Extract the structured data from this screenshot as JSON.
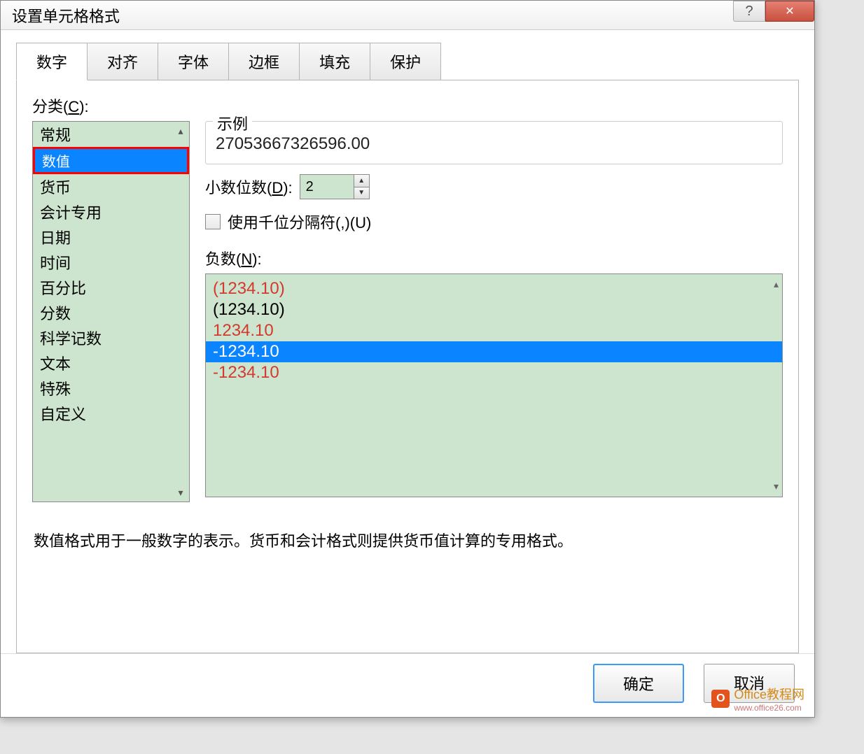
{
  "titlebar": {
    "title": "设置单元格格式",
    "help_symbol": "?",
    "close_symbol": "✕"
  },
  "tabs": [
    {
      "label": "数字",
      "active": true
    },
    {
      "label": "对齐",
      "active": false
    },
    {
      "label": "字体",
      "active": false
    },
    {
      "label": "边框",
      "active": false
    },
    {
      "label": "填充",
      "active": false
    },
    {
      "label": "保护",
      "active": false
    }
  ],
  "category": {
    "label_prefix": "分类(",
    "label_ul": "C",
    "label_suffix": "):",
    "items": [
      {
        "label": "常规",
        "selected": false,
        "highlighted": false
      },
      {
        "label": "数值",
        "selected": true,
        "highlighted": true
      },
      {
        "label": "货币",
        "selected": false,
        "highlighted": false
      },
      {
        "label": "会计专用",
        "selected": false,
        "highlighted": false
      },
      {
        "label": "日期",
        "selected": false,
        "highlighted": false
      },
      {
        "label": "时间",
        "selected": false,
        "highlighted": false
      },
      {
        "label": "百分比",
        "selected": false,
        "highlighted": false
      },
      {
        "label": "分数",
        "selected": false,
        "highlighted": false
      },
      {
        "label": "科学记数",
        "selected": false,
        "highlighted": false
      },
      {
        "label": "文本",
        "selected": false,
        "highlighted": false
      },
      {
        "label": "特殊",
        "selected": false,
        "highlighted": false
      },
      {
        "label": "自定义",
        "selected": false,
        "highlighted": false
      }
    ]
  },
  "sample": {
    "legend": "示例",
    "value": "27053667326596.00"
  },
  "decimal": {
    "label_prefix": "小数位数(",
    "label_ul": "D",
    "label_suffix": "):",
    "value": "2"
  },
  "thousands": {
    "checked": false,
    "label_prefix": "使用千位分隔符(,)(",
    "label_ul": "U",
    "label_suffix": ")"
  },
  "negatives": {
    "label_prefix": "负数(",
    "label_ul": "N",
    "label_suffix": "):",
    "items": [
      {
        "text": "(1234.10)",
        "color": "red",
        "selected": false
      },
      {
        "text": "(1234.10)",
        "color": "black",
        "selected": false
      },
      {
        "text": "1234.10",
        "color": "red",
        "selected": false
      },
      {
        "text": "-1234.10",
        "color": "white",
        "selected": true
      },
      {
        "text": "-1234.10",
        "color": "red",
        "selected": false
      }
    ]
  },
  "description": "数值格式用于一般数字的表示。货币和会计格式则提供货币值计算的专用格式。",
  "buttons": {
    "ok": "确定",
    "cancel": "取消"
  },
  "watermark": {
    "brand": "Office教程网",
    "url": "www.office26.com",
    "icon": "O"
  }
}
